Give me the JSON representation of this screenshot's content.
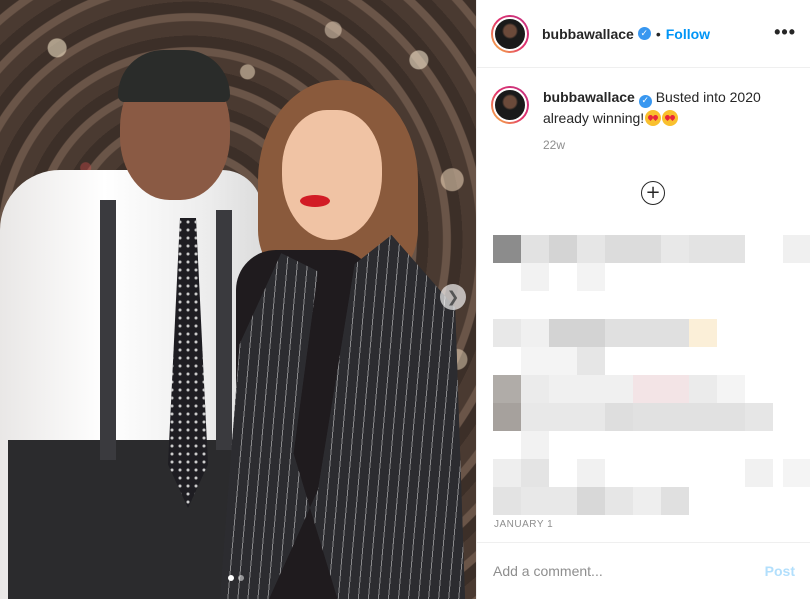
{
  "post": {
    "username": "bubbawallace",
    "verified_icon": "verified-badge-icon",
    "follow_label": "Follow",
    "bullet": "•",
    "more_label": "•••",
    "caption": "Busted into 2020 already winning!",
    "time_ago": "22w",
    "date": "JANUARY 1",
    "carousel": {
      "count": 2,
      "active_index": 0
    },
    "next_icon": "chevron-right-icon",
    "load_more_icon": "plus-circle-icon"
  },
  "comment": {
    "placeholder": "Add a comment...",
    "post_label": "Post"
  },
  "colors": {
    "accent": "#0095f6",
    "post_disabled": "#b2dffc",
    "muted": "#8e8e8e",
    "emoji": "#f9c02e"
  }
}
